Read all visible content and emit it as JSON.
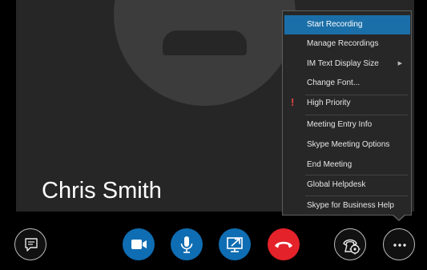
{
  "participant": {
    "name": "Chris Smith"
  },
  "menu": {
    "items": [
      {
        "label": "Start Recording",
        "highlighted": true
      },
      {
        "label": "Manage Recordings"
      },
      {
        "label": "IM Text Display Size",
        "submenu": true
      },
      {
        "label": "Change Font..."
      },
      {
        "label": "High Priority",
        "icon": "exclamation-icon"
      },
      {
        "label": "Meeting Entry Info"
      },
      {
        "label": "Skype Meeting Options"
      },
      {
        "label": "End Meeting"
      },
      {
        "label": "Global Helpdesk"
      },
      {
        "label": "Skype for Business Help"
      }
    ]
  },
  "controls": [
    {
      "name": "chat-button",
      "icon": "chat-icon"
    },
    {
      "name": "video-button",
      "icon": "video-camera-icon"
    },
    {
      "name": "mic-button",
      "icon": "microphone-icon"
    },
    {
      "name": "present-button",
      "icon": "share-screen-icon"
    },
    {
      "name": "hang-up-button",
      "icon": "hang-up-icon"
    },
    {
      "name": "call-controls-button",
      "icon": "phone-gear-icon"
    },
    {
      "name": "more-options-button",
      "icon": "ellipsis-icon"
    }
  ],
  "colors": {
    "accent_blue": "#0f6db3",
    "hang_up_red": "#e4222a",
    "menu_highlight": "#1b6fa8",
    "priority_red": "#e4463e"
  }
}
